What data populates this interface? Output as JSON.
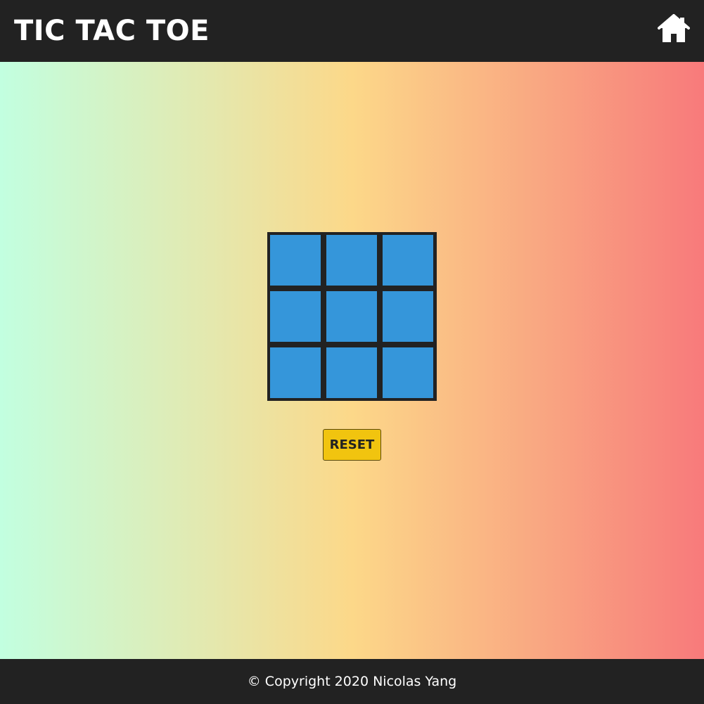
{
  "header": {
    "title": "TIC TAC TOE",
    "home_icon": "home-icon"
  },
  "board": {
    "cells": [
      "",
      "",
      "",
      "",
      "",
      "",
      "",
      "",
      ""
    ],
    "cell_color": "#3596da",
    "grid_color": "#222222"
  },
  "controls": {
    "reset_label": "RESET",
    "reset_color": "#f1c40f"
  },
  "background": {
    "gradient_colors": [
      "#c2ffe0",
      "#e4e8ae",
      "#fcd889",
      "#f9aa82",
      "#f87a7b"
    ]
  },
  "footer": {
    "copyright": "© Copyright 2020 Nicolas Yang"
  }
}
